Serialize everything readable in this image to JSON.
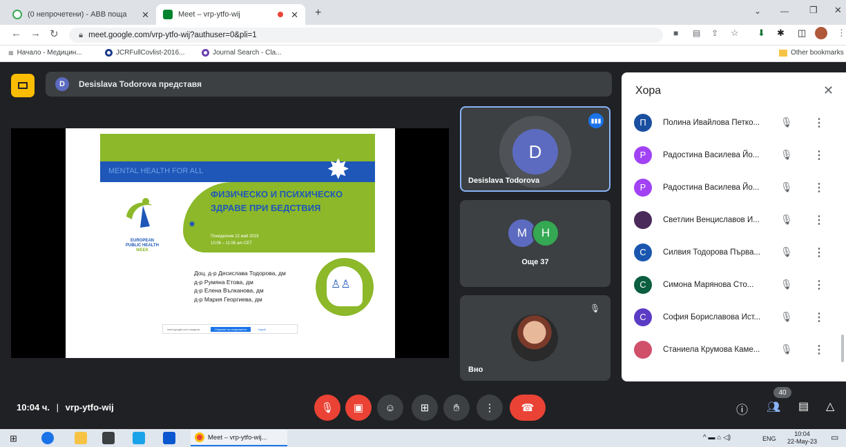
{
  "tabs": [
    {
      "title": "(0 непрочетени) - ABB поща",
      "active": false
    },
    {
      "title": "Meet – vrp-ytfo-wij",
      "active": true
    }
  ],
  "new_tab_label": "+",
  "address": "meet.google.com/vrp-ytfo-wij?authuser=0&pli=1",
  "bookmarks": [
    "Начало - Медицин...",
    "JCRFullCovlist-2016...",
    "Journal Search - Cla..."
  ],
  "other_bookmarks": "Other bookmarks",
  "presenting_banner": {
    "avatar_letter": "D",
    "text": "Desislava Todorova представя"
  },
  "slide": {
    "banner": "MENTAL HEALTH FOR ALL",
    "title_line1": "ФИЗИЧЕСКО И ПСИХИЧЕСКО",
    "title_line2": "ЗДРАВЕ ПРИ БЕДСТВИЯ",
    "date_line1": "Понеделник 22 май 2023",
    "date_line2": "10:06 – 11:06 am CET",
    "org_line1": "EUROPEAN",
    "org_line2": "PUBLIC HEALTH",
    "org_line3": "WEEK",
    "authors": [
      "Доц. д-р Десислава Тодорова, дм",
      "д-р Румяна Етова, дм",
      "д-р Елена Вълканова, дм",
      "д-р Мария Георгиева, дм"
    ],
    "share_bar_left": "meet.google.com споделя",
    "share_bar_button": "Спиране на споделянето",
    "share_bar_hide": "Скрий"
  },
  "tiles": [
    {
      "avatar_letter": "D",
      "name": "Desislava Todorova",
      "speaking": true
    },
    {
      "avatar_letters": [
        "M",
        "H"
      ],
      "name": "Още 37"
    },
    {
      "name": "Вно",
      "muted": true
    }
  ],
  "bottom": {
    "time": "10:04 ч.",
    "separator": "|",
    "meeting_code": "vrp-ytfo-wij",
    "people_count": "40"
  },
  "people_panel": {
    "title": "Хора",
    "participants": [
      {
        "letter": "П",
        "name": "Полина Ивайлова Петко...",
        "color": "#1a4fa0"
      },
      {
        "letter": "Р",
        "name": "Радостина Василева Йо...",
        "color": "#a142f4"
      },
      {
        "letter": "Р",
        "name": "Радостина Василева Йо...",
        "color": "#a142f4"
      },
      {
        "letter": "",
        "name": "Светлин Венциславов И...",
        "color": "#4a2a5a"
      },
      {
        "letter": "С",
        "name": "Силвия Тодорова Първа...",
        "color": "#1a56b0"
      },
      {
        "letter": "С",
        "name": "Симона Марянова Сто...",
        "color": "#0b5e3f"
      },
      {
        "letter": "С",
        "name": "София Бориславова Ист...",
        "color": "#5b3cc4"
      },
      {
        "letter": "",
        "name": "Станиела Крумова Каме...",
        "color": "#d0506a"
      }
    ]
  },
  "taskbar": {
    "app_label": "Meet – vrp-ytfo-wij...",
    "lang": "ENG",
    "clock_time": "10:04",
    "clock_date": "22-May-23"
  },
  "colors": {
    "meet_bg": "#202124",
    "accent_red": "#ea4335",
    "slide_green": "#8cb82a",
    "slide_blue": "#1e57b8"
  }
}
